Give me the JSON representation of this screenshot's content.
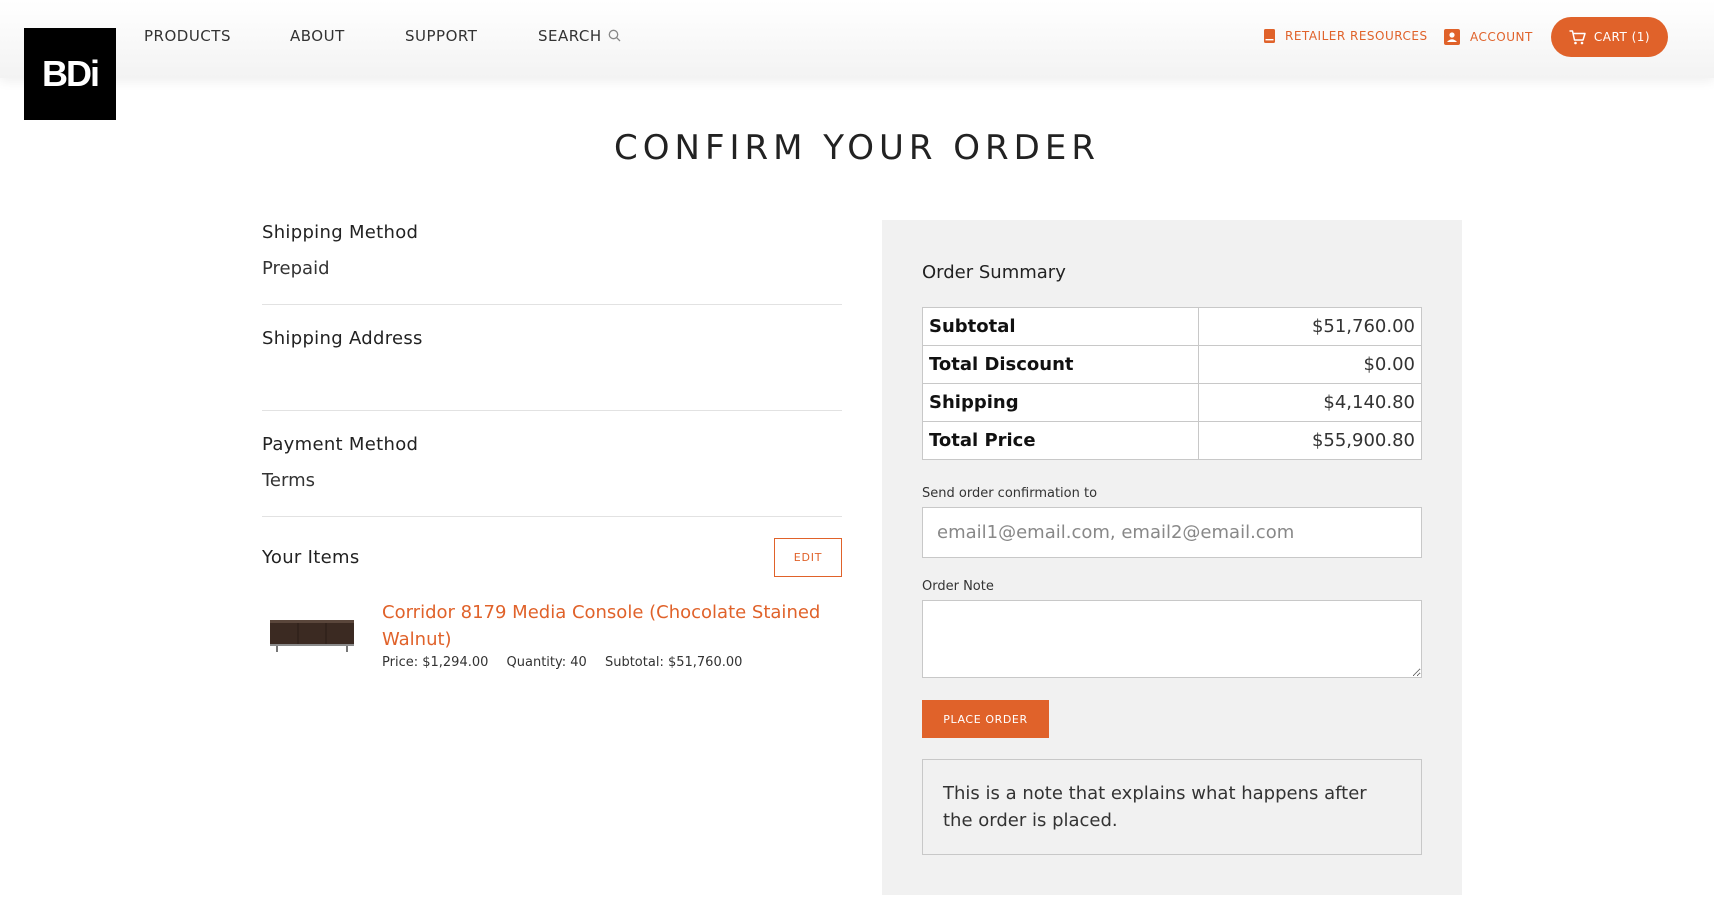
{
  "brand": {
    "logo_text": "BDi",
    "accent": "#e0622a"
  },
  "nav": {
    "items": [
      {
        "label": "PRODUCTS"
      },
      {
        "label": "ABOUT"
      },
      {
        "label": "SUPPORT"
      },
      {
        "label": "SEARCH",
        "icon": "search-icon"
      }
    ],
    "retailer_resources": {
      "label": "RETAILER RESOURCES",
      "icon": "book-icon"
    },
    "account": {
      "label": "ACCOUNT",
      "icon": "account-icon"
    },
    "cart": {
      "label": "CART (1)",
      "icon": "cart-icon"
    }
  },
  "page": {
    "title": "CONFIRM YOUR ORDER"
  },
  "shipping_method": {
    "heading": "Shipping Method",
    "value": "Prepaid"
  },
  "shipping_address": {
    "heading": "Shipping Address",
    "value": ""
  },
  "payment_method": {
    "heading": "Payment Method",
    "value": "Terms"
  },
  "items": {
    "heading": "Your Items",
    "edit_label": "EDIT",
    "list": [
      {
        "name": "Corridor 8179 Media Console (Chocolate Stained Walnut)",
        "price": "Price: $1,294.00",
        "quantity": "Quantity: 40",
        "subtotal": "Subtotal: $51,760.00"
      }
    ]
  },
  "summary": {
    "title": "Order Summary",
    "rows": [
      {
        "label": "Subtotal",
        "value": "$51,760.00"
      },
      {
        "label": "Total Discount",
        "value": "$0.00"
      },
      {
        "label": "Shipping",
        "value": "$4,140.80"
      },
      {
        "label": "Total Price",
        "value": "$55,900.80"
      }
    ],
    "email_label": "Send order confirmation to",
    "email_placeholder": "email1@email.com, email2@email.com",
    "email_value": "",
    "note_label": "Order Note",
    "note_value": "",
    "place_order_label": "PLACE ORDER",
    "after_note": "This is a note that explains what happens after the order is placed."
  }
}
